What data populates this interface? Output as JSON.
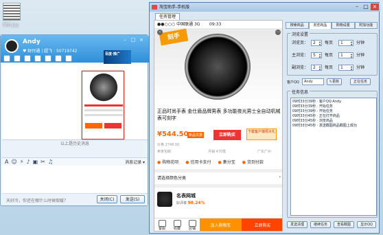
{
  "desktop": {
    "icon_label": "微信.jpg"
  },
  "qq_chat": {
    "contact_name": "Andy",
    "contact_sub": "♥ 财付通 | 超飞 : 50719742",
    "history_link": "以上是历史消息",
    "message_record": "消息记录 ▾",
    "bottom_tip": "天好冷，你还在哪什么时候取暖？",
    "close_button": "关闭(C)",
    "send_button": "发送(S)",
    "ad_text": "百度·推广"
  },
  "helper": {
    "window_title": "淘宝助手-手机版",
    "outer_tab": "任务管理",
    "phone": {
      "carrier": "●●○○○ 中国联通  3G",
      "time": "09:33",
      "badge": "刻手",
      "product_title": "正品时尚手表 金仕盾品牌男表 多功能夜光男士全自动机械表可刻字",
      "price": "¥544.50",
      "price_tag": "新品优惠",
      "buy_label": "立即购买",
      "cta_label": "下载客户端领大礼",
      "original_price": "价格 2748.00",
      "shipping": "卖家包邮",
      "monthly_sales": "月销 470笔",
      "location": "广东广州",
      "services": [
        "购物花呗",
        "信用卡支付",
        "集分宝",
        "货到付款"
      ],
      "choose_label": "请选择颜色分类",
      "shop_name": "名表网城",
      "shop_rating_label": "好评率",
      "shop_rating": "98.24%",
      "nav": [
        "客服",
        "收藏",
        "店铺"
      ],
      "add_cart": "加入购物车",
      "buy_now": "立即购买"
    },
    "tabs": [
      {
        "label": "搜索商品",
        "active": false
      },
      {
        "label": "浏览商品",
        "active": true
      },
      {
        "label": "购物设置",
        "active": false
      },
      {
        "label": "附加功能",
        "active": false
      }
    ],
    "browse_settings": {
      "group_label": "浏览设置",
      "rows": [
        {
          "label": "浏览页：",
          "count": "2",
          "per": "每页",
          "minutes": "1",
          "unit": "分钟"
        },
        {
          "label": "主浏览：",
          "count": "5",
          "per": "每页",
          "minutes": "1",
          "unit": "分钟"
        },
        {
          "label": "副浏览：",
          "count": "2",
          "per": "每页",
          "minutes": "1",
          "unit": "分钟"
        }
      ]
    },
    "client": {
      "label": "客户QQ",
      "value": "Andy",
      "refresh": "↻更新",
      "status": "正在任务"
    },
    "task_info": {
      "group_label": "任务信息",
      "lines": [
        "09时33分39秒 · 客户QQ:Andy",
        "09时33分39秒 · 开始任务",
        "09时33分39秒 · 开始任务",
        "09时33分45秒 · 正在打开商品",
        "09时33分45秒 · 浏览商品",
        "09时33分45秒 · 发送截图商品截图上成功"
      ]
    },
    "bottom_buttons": [
      "发送清理",
      "继续任务",
      "查看截图",
      "显示QQ"
    ]
  }
}
